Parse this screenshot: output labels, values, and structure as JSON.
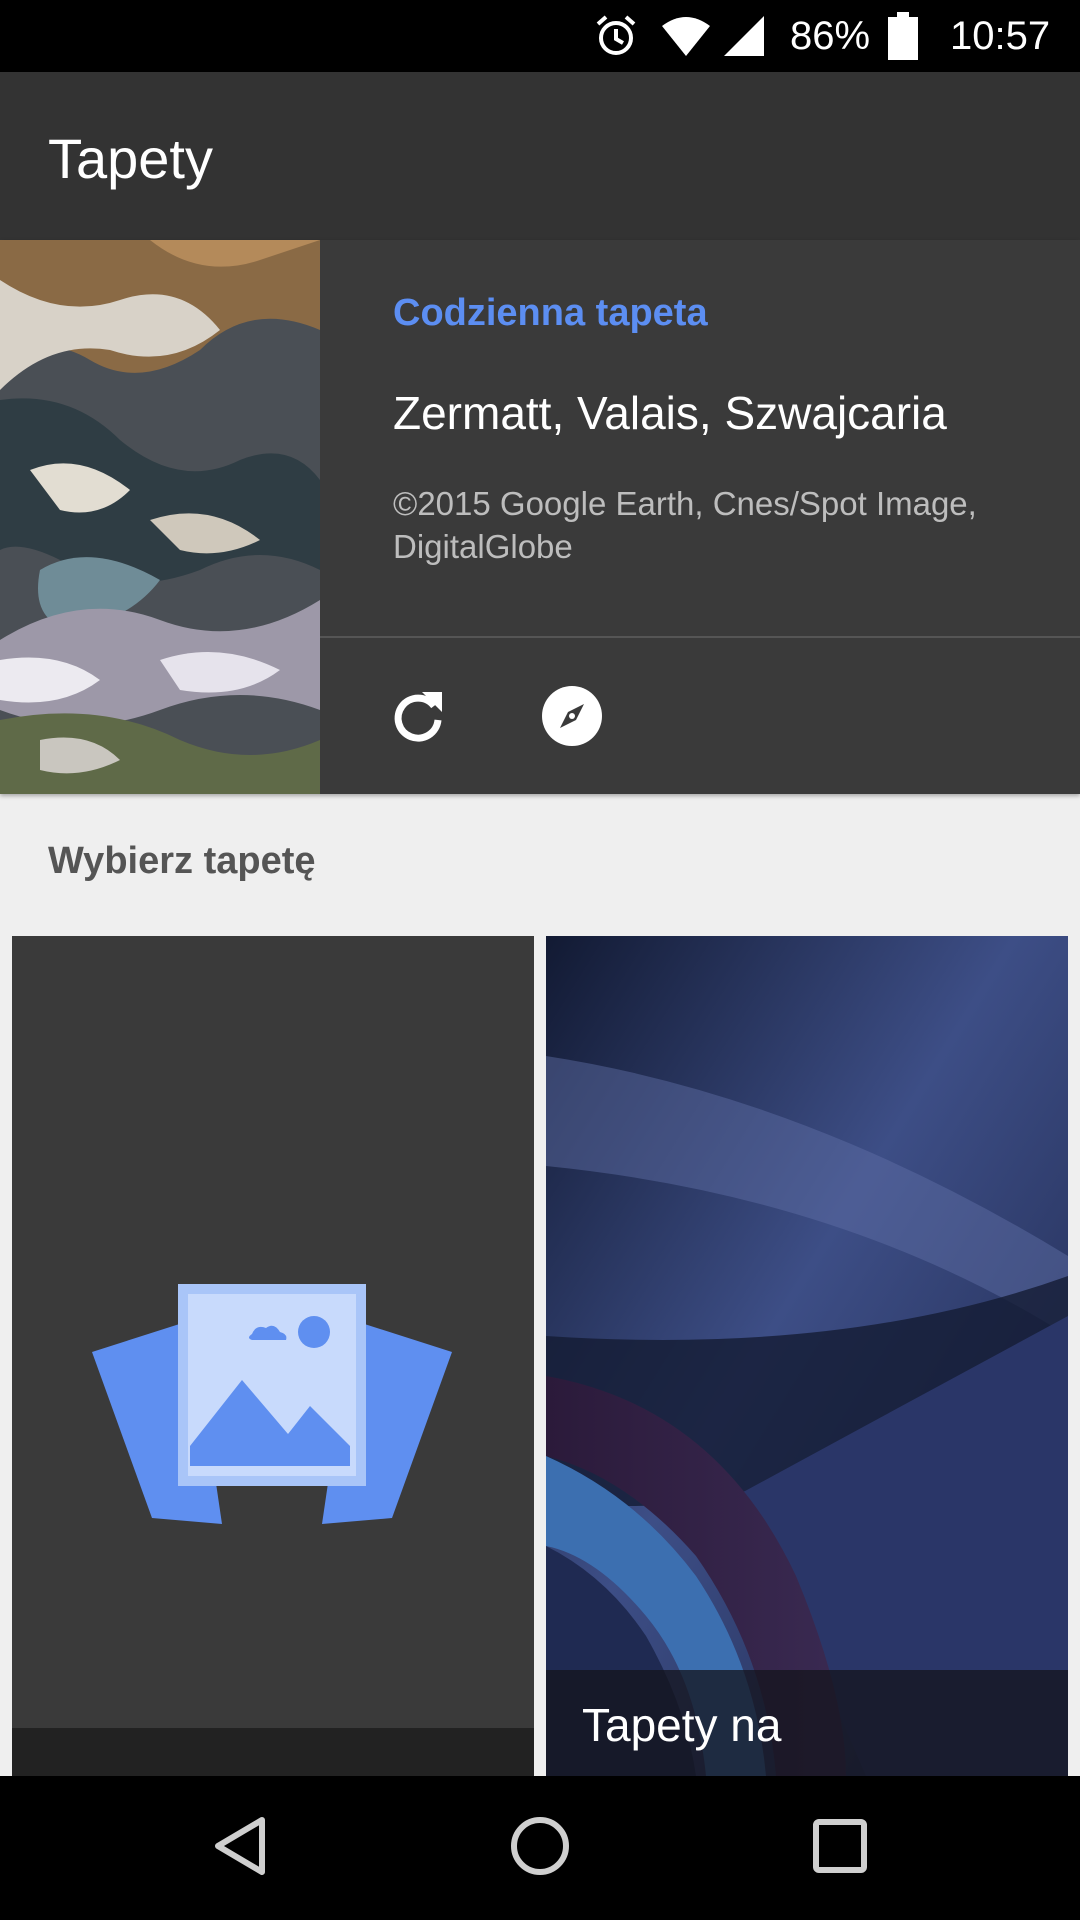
{
  "status_bar": {
    "battery": "86%",
    "time": "10:57",
    "icons": [
      "alarm-icon",
      "wifi-icon",
      "signal-icon",
      "battery-icon"
    ]
  },
  "app_bar": {
    "title": "Tapety"
  },
  "daily_wallpaper": {
    "label": "Codzienna tapeta",
    "location": "Zermatt, Valais, Szwajcaria",
    "attribution": "©2015 Google Earth, Cnes/Spot Image, DigitalGlobe",
    "actions": [
      "refresh-icon",
      "explore-icon"
    ]
  },
  "picker": {
    "section_title": "Wybierz tapetę",
    "tiles": [
      {
        "label": "",
        "icon": "my-photos-icon"
      },
      {
        "label": "Tapety na"
      }
    ]
  },
  "nav_bar": {
    "buttons": [
      "back-icon",
      "home-icon",
      "recents-icon"
    ]
  },
  "colors": {
    "accent": "#5c8ef2",
    "app_bar": "#333333",
    "card": "#3a3a3a",
    "background": "#efefef"
  }
}
